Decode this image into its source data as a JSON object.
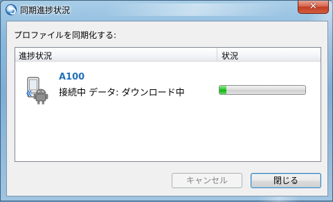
{
  "window": {
    "title": "同期進捗状況",
    "close_label": "✕"
  },
  "dialog": {
    "prompt": "プロファイルを同期化する:",
    "list": {
      "columns": [
        "進捗状況",
        "状況"
      ],
      "rows": [
        {
          "icon": "phone-android-icon",
          "name": "A100",
          "status": "接続中 データ: ダウンロード中",
          "progress": 0.08
        }
      ]
    },
    "buttons": {
      "cancel": "キャンセル",
      "close": "閉じる"
    }
  },
  "colors": {
    "device_name": "#2271b8",
    "progress_fill": "#14b014"
  }
}
